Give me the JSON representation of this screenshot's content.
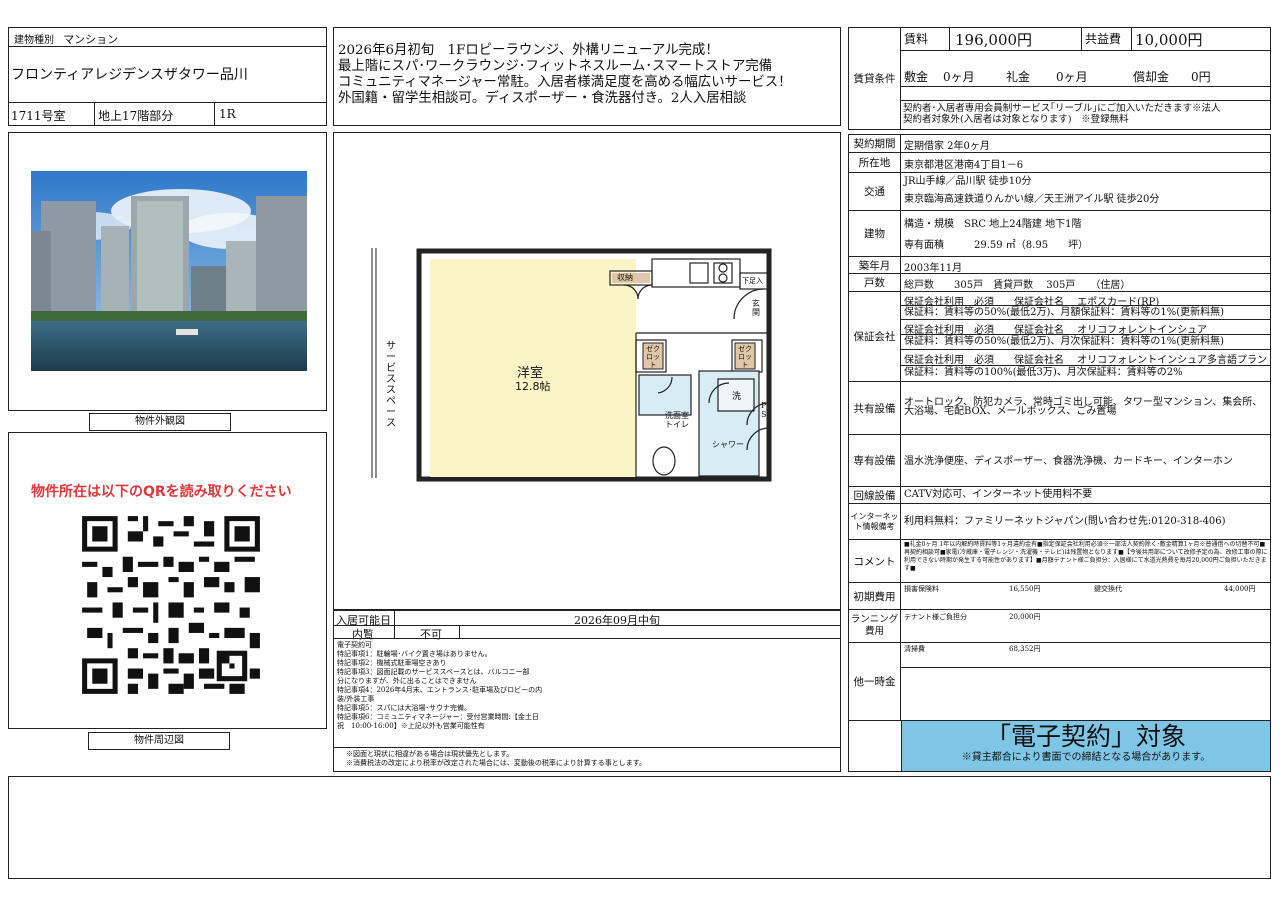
{
  "header": {
    "building_type_label": "建物種別",
    "building_type": "マンション",
    "building_name": "フロンティアレジデンスザタワー品川",
    "room_no": "1711号室",
    "floor": "地上17階部分",
    "layout": "1R"
  },
  "headline": [
    "2026年6月初旬　1Fロビーラウンジ、外構リニューアル完成！",
    "最上階にスパ･ワークラウンジ･フィットネスルーム･スマートストア完備",
    "コミュニティマネージャー常駐。入居者様満足度を高める幅広いサービス！",
    "外国籍・留学生相談可。ディスポーザー・食洗器付き。2人入居相談"
  ],
  "photo_caption": "物件外観図",
  "map_caption": "物件周辺図",
  "qr_notice": "物件所在は以下のQRを読み取りください",
  "floorplan": {
    "room_name": "洋室",
    "room_size": "12.8帖",
    "service_space": "サービススペース",
    "storage": "収納",
    "shoe_box": "下足入",
    "entrance": "玄関",
    "closet1": "ゼクロット",
    "closet2": "ゼクロット",
    "washroom": "洗面室トイレ",
    "shower": "シャワー",
    "wash": "洗",
    "ps": "PS"
  },
  "move_in": {
    "label": "入居可能日",
    "value": "2026年09月中旬"
  },
  "viewing": {
    "label": "内覧",
    "value": "不可"
  },
  "notes": [
    "電子契約可",
    "特記事項1：駐輪場･バイク置き場はありません。",
    "特記事項2：機械式駐車場空きあり",
    "特記事項3：図面記載のサービススペースとは、バルコニー部",
    "分になりますが、外に出ることはできません",
    "特記事項4：2026年4月末、エントランス･駐車場及びロビーの内",
    "装/外装工事",
    "特記事項5：スパには大浴場･サウナ完備。",
    "特記事項6：コミュニティマネージャー：受付営業時間:【金土日",
    "祝　10:00-16:00】※上記以外も営業可能性有"
  ],
  "footnotes": [
    "※図面と現状に相違がある場合は現状優先とします。",
    "※消費税法の改定により税率が改定された場合には、変動後の税率により計算する事とします。"
  ],
  "rent": {
    "section_label": "賃貸条件",
    "rent_label": "賃料",
    "rent_value": "196,000円",
    "common_label": "共益費",
    "common_value": "10,000円",
    "deposit_label": "敷金",
    "deposit_value": "0ヶ月",
    "key_label": "礼金",
    "key_value": "0ヶ月",
    "amort_label": "償却金",
    "amort_value": "0円",
    "member_note_1": "契約者･入居者専用会員制サービス｢リーブル｣にご加入いただきます※法人",
    "member_note_2": "契約者対象外(入居者は対象となります)　※登録無料"
  },
  "details": {
    "contract_label": "契約期間",
    "contract_value": "定期借家 2年0ヶ月",
    "address_label": "所在地",
    "address_value": "東京都港区港南4丁目1－6",
    "transport_label": "交通",
    "transport_1": "JR山手線／品川駅 徒歩10分",
    "transport_2": "東京臨海高速鉄道りんかい線／天王洲アイル駅 徒歩20分",
    "building_label": "建物",
    "structure": "構造・規模　SRC 地上24階建 地下1階",
    "area": "専有面積　　　29.59 ㎡（8.95　　坪）",
    "built_label": "築年月",
    "built_value": "2003年11月",
    "units_label": "戸数",
    "units_value": "総戸数　　305戸　賃貸戸数　 305戸　　（住居）",
    "guarantee_label": "保証会社",
    "g1": "保証会社利用　必須　　保証会社名　 エポスカード(RP)",
    "g1_note": "保証料：賃料等の50%(最低2万)、月額保証料：賃料等の1%(更新料無)",
    "g2": "保証会社利用　必須　　保証会社名　 オリコフォレントインシュア",
    "g2_note": "保証料：賃料等の50%(最低2万)、月次保証料：賃料等の1%(更新料無)",
    "g3": "保証会社利用　必須　　保証会社名　 オリコフォレントインシュア多言語プラン",
    "g3_note": "保証料：賃料等の100%(最低3万)、月次保証料：賃料等の2%",
    "shared_label": "共有設備",
    "shared_value": "オートロック、防犯カメラ、常時ゴミ出し可能、タワー型マンション、集会所、大浴場、宅配BOX、メールボックス、ごみ置場",
    "private_label": "専有設備",
    "private_value": "温水洗浄便座、ディスポーザー、食器洗浄機、カードキー、インターホン",
    "line_label": "回線設備",
    "line_value": "CATV対応可、インターネット使用料不要",
    "internet_label": "インターネット情報備考",
    "internet_value": "利用料無料：ファミリーネットジャパン(問い合わせ先:0120-318-406)",
    "comment_label": "コメント",
    "comment_value": "■礼金0ヶ月 1年以内解約時賃料等1ヶ月違約金有■指定保証会社利用必須※一部法人契約除く･敷金精算1ヶ月※普通借への切替不可■再契約相談可■家電(冷蔵庫・電子レンジ・洗濯機・テレビ)は残置物となります■【今後共用部について改修予定の為、改修工事の際に利用できない時期が発生する可能性があります】■月額テナント様ご負担分：入居様にて水道光熱費を毎月20,000円ご負担いただきます■",
    "initial_label": "初期費用",
    "initial_1": "損害保険料",
    "initial_1_val": "16,550円",
    "initial_2": "鍵交換代",
    "initial_2_val": "44,000円",
    "running_label": "ランニング費用",
    "running_1": "テナント様ご負担分",
    "running_1_val": "20,000円",
    "onetime_label": "他一時金",
    "onetime_1": "清掃費",
    "onetime_1_val": "68,352円"
  },
  "econtract": {
    "title": "「電子契約」対象",
    "note": "※貸主都合により書面での締結となる場合があります。"
  }
}
